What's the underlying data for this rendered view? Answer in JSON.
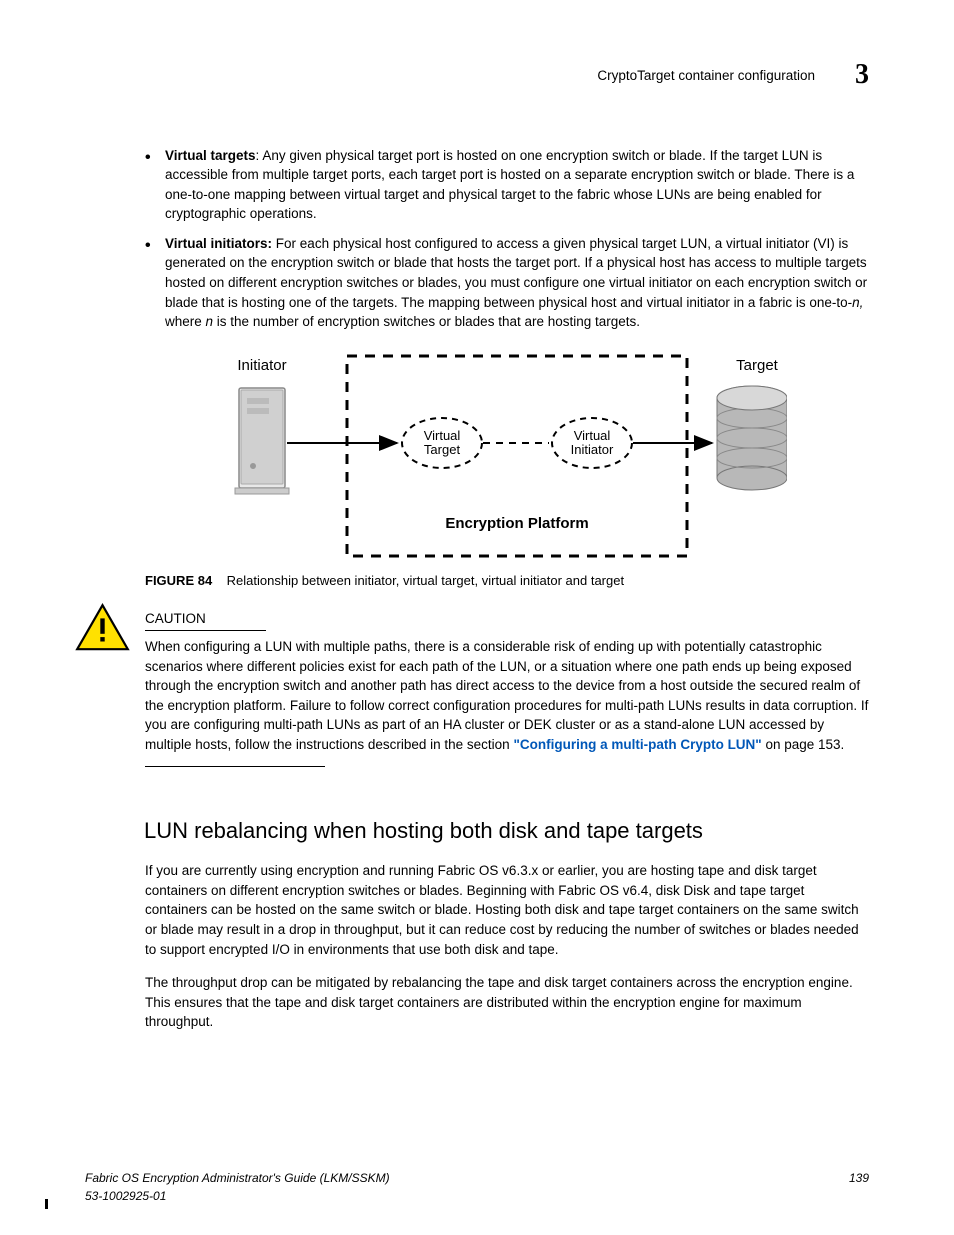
{
  "header": {
    "title": "CryptoTarget container configuration",
    "chapter": "3"
  },
  "bullets": [
    {
      "term": "Virtual targets",
      "sep": ": ",
      "text": "Any given physical target port is hosted on one encryption switch or blade. If the target LUN is accessible from multiple target ports, each target port is hosted on a separate encryption switch or blade. There is a one-to-one mapping between virtual target and physical target to the fabric whose LUNs are being enabled for cryptographic operations."
    },
    {
      "term": "Virtual initiators:",
      "sep": " ",
      "text_a": "For each physical host configured to access a given physical target LUN, a virtual initiator (VI) is generated on the encryption switch or blade that hosts the target port. If a physical host has access to multiple targets hosted on different encryption switches or blades, you must configure one virtual initiator on each encryption switch or blade that is hosting one of the targets. The mapping between physical host and virtual initiator in a fabric is one-to-",
      "italic_a": "n,",
      "text_b": " where ",
      "italic_b": "n",
      "text_c": " is the number of encryption switches or blades that are hosting targets."
    }
  ],
  "diagram": {
    "initiator": "Initiator",
    "virtual_target": "Virtual",
    "virtual_target2": "Target",
    "virtual_initiator": "Virtual",
    "virtual_initiator2": "Initiator",
    "target": "Target",
    "platform": "Encryption Platform"
  },
  "figure": {
    "label": "FIGURE 84",
    "caption": "Relationship between initiator, virtual target, virtual initiator and target"
  },
  "caution": {
    "label": "CAUTION",
    "text_a": "When configuring a LUN with multiple paths, there is a considerable risk of ending up with potentially catastrophic scenarios where different policies exist for each path of the LUN, or a situation where one path ends up being exposed through the encryption switch and another path has direct access to the device from a host outside the secured realm of the encryption platform. Failure to follow correct configuration procedures for multi-path LUNs results in data corruption. If you are configuring multi-path LUNs as part of an HA cluster or DEK cluster or as a stand-alone LUN accessed by multiple hosts, follow the instructions described in the section ",
    "link": "\"Configuring a multi-path Crypto LUN\"",
    "text_b": " on page 153."
  },
  "section": {
    "title": "LUN rebalancing when hosting both disk and tape targets",
    "p1": "If you are currently using encryption and running Fabric OS v6.3.x or earlier, you are hosting tape and disk target containers on different encryption switches or blades. Beginning with Fabric OS v6.4, disk Disk and tape target containers can be hosted on the same switch or blade. Hosting both disk and tape target containers on the same switch or blade may result in a drop in throughput, but it can reduce cost by reducing the number of switches or blades needed to support encrypted I/O in environments that use both disk and tape.",
    "p2": "The throughput drop can be mitigated by rebalancing the tape and disk target containers across the encryption engine. This ensures that the tape and disk target containers are distributed within the encryption engine for maximum throughput."
  },
  "footer": {
    "left1": "Fabric OS Encryption Administrator's Guide  (LKM/SSKM)",
    "left2": "53-1002925-01",
    "page": "139"
  }
}
